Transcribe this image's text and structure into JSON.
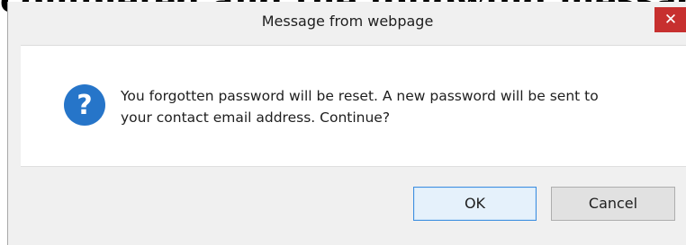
{
  "background": {
    "clipped_text": "completed and the following message sho"
  },
  "dialog": {
    "title": "Message from webpage",
    "close_label": "✕",
    "icon": "question-icon",
    "icon_color": "#2675c9",
    "message_line1": "You forgotten password will be reset. A new password will be sent to",
    "message_line2": "your contact email address. Continue?",
    "buttons": {
      "ok": "OK",
      "cancel": "Cancel"
    }
  }
}
